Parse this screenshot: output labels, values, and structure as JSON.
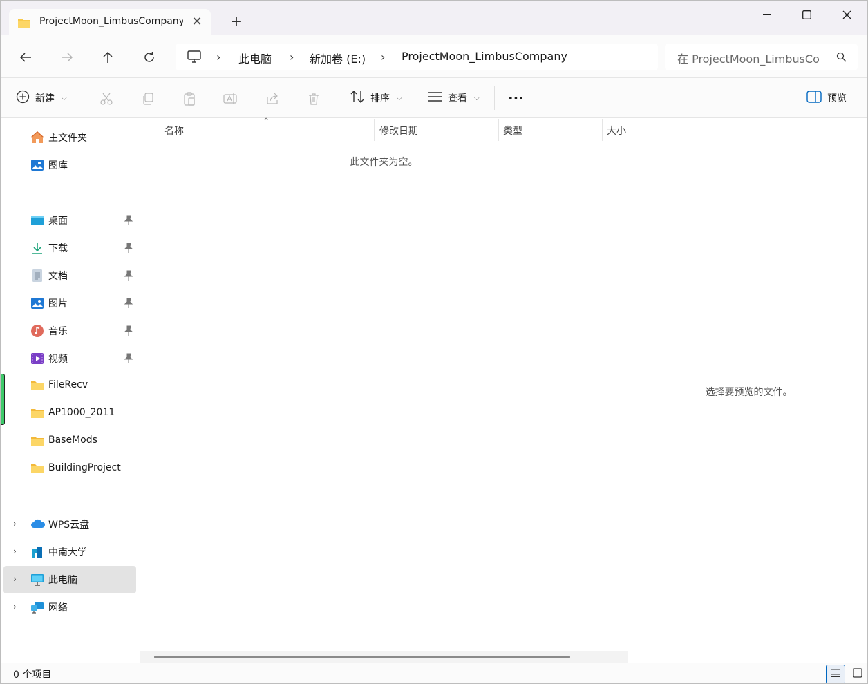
{
  "tab": {
    "title": "ProjectMoon_LimbusCompany"
  },
  "address": {
    "crumbs": [
      "此电脑",
      "新加卷 (E:)",
      "ProjectMoon_LimbusCompany"
    ],
    "search_placeholder": "在 ProjectMoon_LimbusCo"
  },
  "toolbar": {
    "new_label": "新建",
    "sort_label": "排序",
    "view_label": "查看",
    "more_label": "···",
    "preview_label": "预览"
  },
  "sidebar": {
    "quick": [
      {
        "label": "主文件夹",
        "icon": "home-icon"
      },
      {
        "label": "图库",
        "icon": "gallery-icon"
      }
    ],
    "pinned": [
      {
        "label": "桌面",
        "icon": "desktop-icon",
        "pinned": true
      },
      {
        "label": "下载",
        "icon": "download-icon",
        "pinned": true
      },
      {
        "label": "文档",
        "icon": "document-icon",
        "pinned": true
      },
      {
        "label": "图片",
        "icon": "pictures-icon",
        "pinned": true
      },
      {
        "label": "音乐",
        "icon": "music-icon",
        "pinned": true
      },
      {
        "label": "视频",
        "icon": "video-icon",
        "pinned": true
      },
      {
        "label": "FileRecv",
        "icon": "folder-icon",
        "pinned": false
      },
      {
        "label": "AP1000_2011",
        "icon": "folder-icon",
        "pinned": false
      },
      {
        "label": "BaseMods",
        "icon": "folder-icon",
        "pinned": false
      },
      {
        "label": "BuildingProject",
        "icon": "folder-icon",
        "pinned": false
      }
    ],
    "locations": [
      {
        "label": "WPS云盘",
        "icon": "cloud-icon"
      },
      {
        "label": "中南大学",
        "icon": "building-icon"
      },
      {
        "label": "此电脑",
        "icon": "computer-icon",
        "selected": true
      },
      {
        "label": "网络",
        "icon": "network-icon"
      }
    ]
  },
  "filelist": {
    "columns": [
      "名称",
      "修改日期",
      "类型",
      "大小"
    ],
    "empty_message": "此文件夹为空。"
  },
  "preview": {
    "message": "选择要预览的文件。"
  },
  "status": {
    "item_count": "0 个项目"
  },
  "colors": {
    "accent": "#0067c0",
    "folder": "#f8c94a",
    "titlebar": "#f2f0f5"
  }
}
